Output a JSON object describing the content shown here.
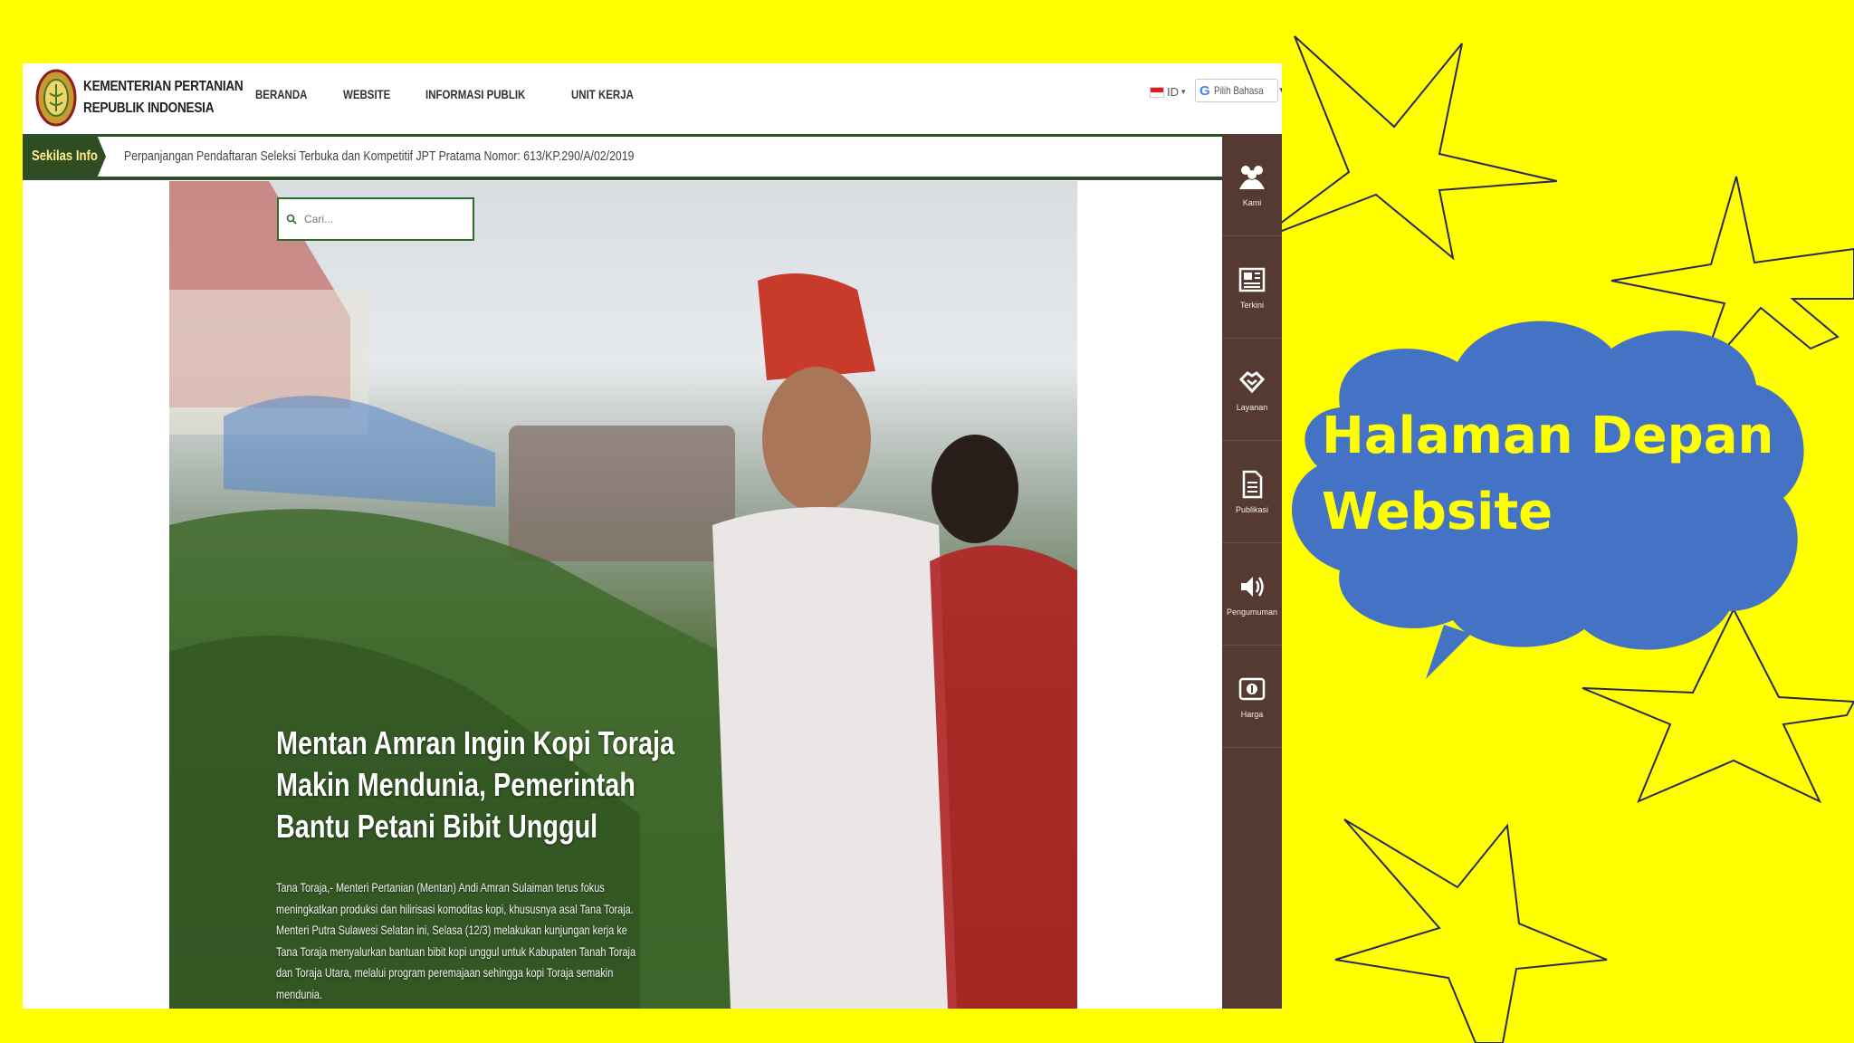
{
  "slide": {
    "callout_text": "Halaman Depan Website",
    "background_color": "#ffff00",
    "callout_color": "#4472c4"
  },
  "header": {
    "brand_line1": "KEMENTERIAN PERTANIAN",
    "brand_line2": "REPUBLIK INDONESIA",
    "nav": [
      "BERANDA",
      "WEBSITE",
      "INFORMASI PUBLIK",
      "UNIT KERJA"
    ],
    "language": "ID",
    "translate_label": "Pilih Bahasa"
  },
  "ticker": {
    "label": "Sekilas Info",
    "text": "Perpanjangan Pendaftaran Seleksi Terbuka dan Kompetitif JPT Pratama Nomor: 613/KP.290/A/02/2019"
  },
  "search": {
    "placeholder": "Cari..."
  },
  "hero": {
    "title": "Mentan Amran Ingin Kopi Toraja Makin Mendunia, Pemerintah Bantu Petani Bibit Unggul",
    "description": "Tana Toraja,- Menteri Pertanian (Mentan) Andi Amran Sulaiman terus fokus meningkatkan produksi dan hilirisasi komoditas kopi, khususnya asal Tana Toraja. Menteri Putra Sulawesi Selatan ini, Selasa (12/3) melakukan kunjungan kerja ke Tana Toraja menyalurkan bantuan bibit kopi unggul untuk Kabupaten Tanah Toraja dan Toraja Utara, melalui program peremajaan sehingga kopi Toraja semakin mendunia.",
    "prev": "‹",
    "next": "›"
  },
  "rail": [
    {
      "label": "Kami",
      "icon": "people-icon"
    },
    {
      "label": "Terkini",
      "icon": "newspaper-icon"
    },
    {
      "label": "Layanan",
      "icon": "handshake-icon"
    },
    {
      "label": "Publikasi",
      "icon": "document-icon"
    },
    {
      "label": "Pengumuman",
      "icon": "speaker-icon"
    },
    {
      "label": "Harga",
      "icon": "money-icon"
    }
  ],
  "colors": {
    "rail": "#553a33",
    "ticker_label": "#2e4d22",
    "accent_green": "#3d7a33"
  }
}
